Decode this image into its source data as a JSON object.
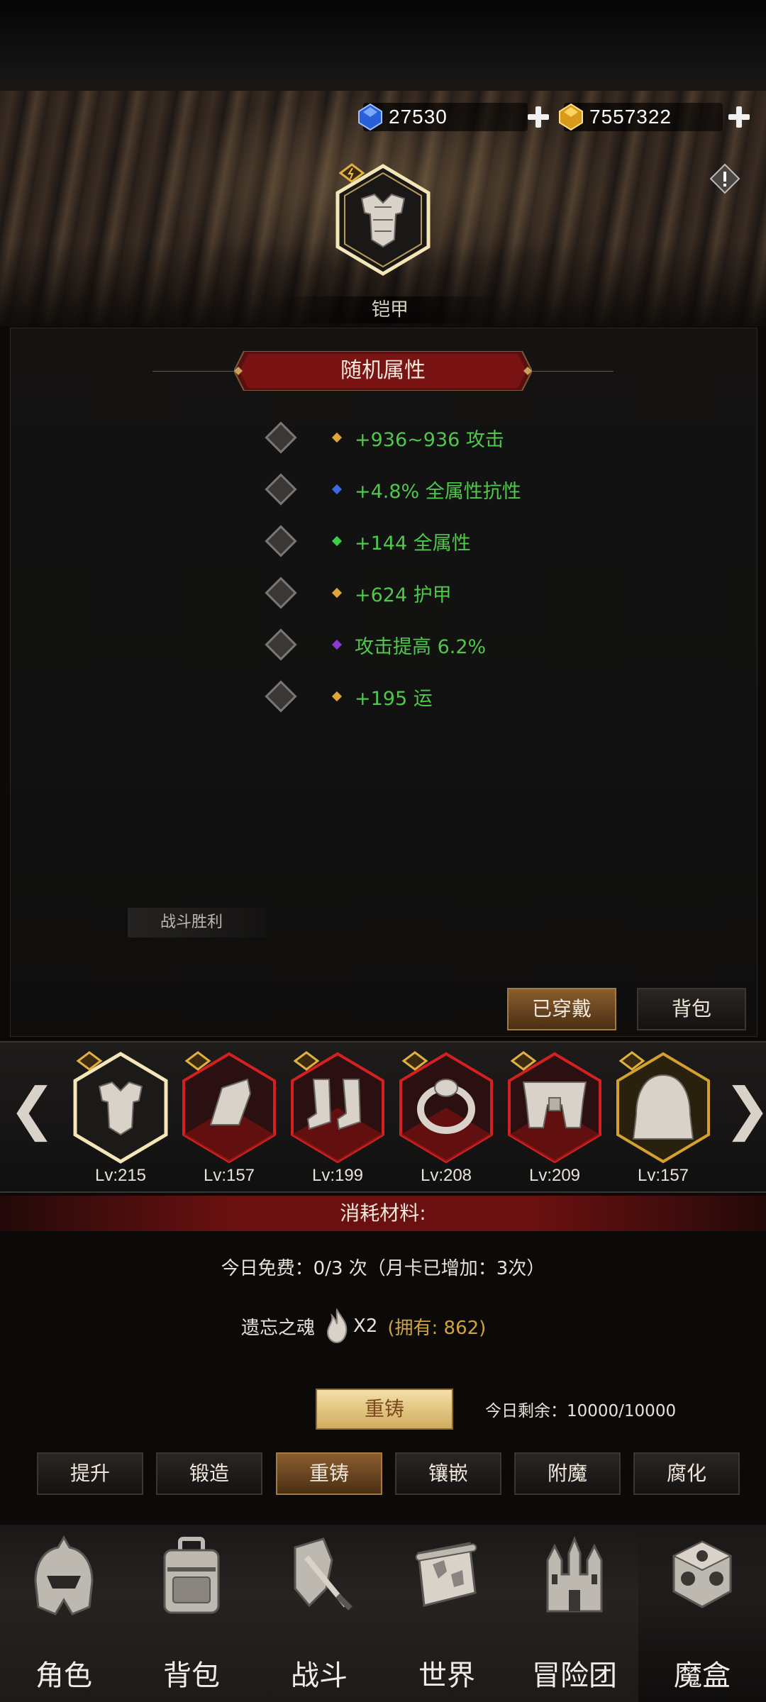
{
  "currency": {
    "blue_gems": "27530",
    "gold_gems": "7557322"
  },
  "selected_item": {
    "name": "铠甲"
  },
  "attributes": {
    "title": "随机属性",
    "rows": [
      {
        "text": "+936~936 攻击",
        "pip_color": "#e0a63a"
      },
      {
        "text": "+4.8% 全属性抗性",
        "pip_color": "#3a6ae0"
      },
      {
        "text": "+144 全属性",
        "pip_color": "#3ad04a"
      },
      {
        "text": "+624 护甲",
        "pip_color": "#e0a63a"
      },
      {
        "text": "攻击提高 6.2%",
        "pip_color": "#8a3ad0"
      },
      {
        "text": "+195 运",
        "pip_color": "#e0a63a"
      }
    ]
  },
  "battle_tag": "战斗胜利",
  "panel_buttons": {
    "equipped": "已穿戴",
    "bag": "背包"
  },
  "equipment": [
    {
      "name": "armor",
      "level": "Lv:215"
    },
    {
      "name": "shoulder",
      "level": "Lv:157"
    },
    {
      "name": "boots",
      "level": "Lv:199"
    },
    {
      "name": "ring",
      "level": "Lv:208"
    },
    {
      "name": "belt",
      "level": "Lv:209"
    },
    {
      "name": "cloak",
      "level": "Lv:157"
    }
  ],
  "materials": {
    "title": "消耗材料:",
    "free_today": "今日免费：0/3 次（月卡已增加：3次）",
    "material_name": "遗忘之魂",
    "material_count": "X2",
    "owned": "(拥有: 862)"
  },
  "reforge": {
    "button": "重铸",
    "remain": "今日剩余：10000/10000"
  },
  "tabs": [
    "提升",
    "锻造",
    "重铸",
    "镶嵌",
    "附魔",
    "腐化"
  ],
  "nav": [
    "角色",
    "背包",
    "战斗",
    "世界",
    "冒险团",
    "魔盒"
  ],
  "colors": {
    "attr_text": "#4fc84a",
    "accent_gold": "#d2a33a",
    "banner_red": "#6a1010"
  }
}
